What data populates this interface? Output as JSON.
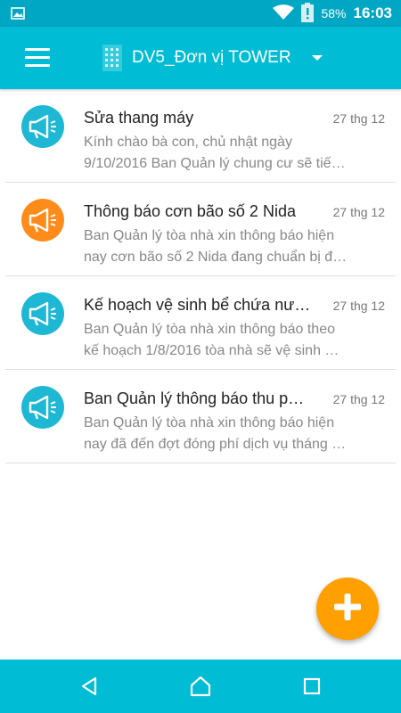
{
  "status_bar": {
    "battery": "58%",
    "time": "16:03",
    "icons": [
      "image-icon",
      "wifi-icon",
      "battery-alert-icon"
    ]
  },
  "app_bar": {
    "title": "DV5_Đơn vị TOWER",
    "icons": [
      "menu-icon",
      "building-icon",
      "dropdown-arrow-icon"
    ]
  },
  "announcements": [
    {
      "title": "Sửa thang máy",
      "date": "27 thg 12",
      "preview_line1": "Kính chào bà con, chủ nhật ngày",
      "preview_line2": "9/10/2016 Ban Quản lý chung cư sẽ tiế…",
      "icon": "megaphone-icon",
      "icon_color": "#1eb8d4"
    },
    {
      "title": "Thông báo cơn bão số 2 Nida",
      "date": "27 thg 12",
      "preview_line1": "Ban Quản lý tòa nhà xin thông báo hiện",
      "preview_line2": "nay cơn bão số 2 Nida đang chuẩn bị đ…",
      "icon": "megaphone-icon",
      "icon_color": "#ff8c1a"
    },
    {
      "title": "Kế hoạch vệ sinh bể chứa nư…",
      "date": "27 thg 12",
      "preview_line1": "Ban Quản lý tòa nhà xin thông báo theo",
      "preview_line2": "kế hoạch 1/8/2016 tòa nhà sẽ vệ sinh …",
      "icon": "megaphone-icon",
      "icon_color": "#1eb8d4"
    },
    {
      "title": "Ban Quản lý thông báo thu p…",
      "date": "27 thg 12",
      "preview_line1": "Ban Quản lý tòa nhà xin thông báo hiện",
      "preview_line2": "nay đã đến đợt đóng phí dịch vụ tháng …",
      "icon": "megaphone-icon",
      "icon_color": "#1eb8d4"
    }
  ],
  "fab": {
    "icon": "plus-icon",
    "color": "#ff9f00"
  },
  "nav_bar": {
    "icons": [
      "back-icon",
      "home-icon",
      "recents-icon"
    ]
  },
  "colors": {
    "primary": "#00bcd4",
    "status_bar": "#00a7c4",
    "accent": "#ff9f00"
  }
}
